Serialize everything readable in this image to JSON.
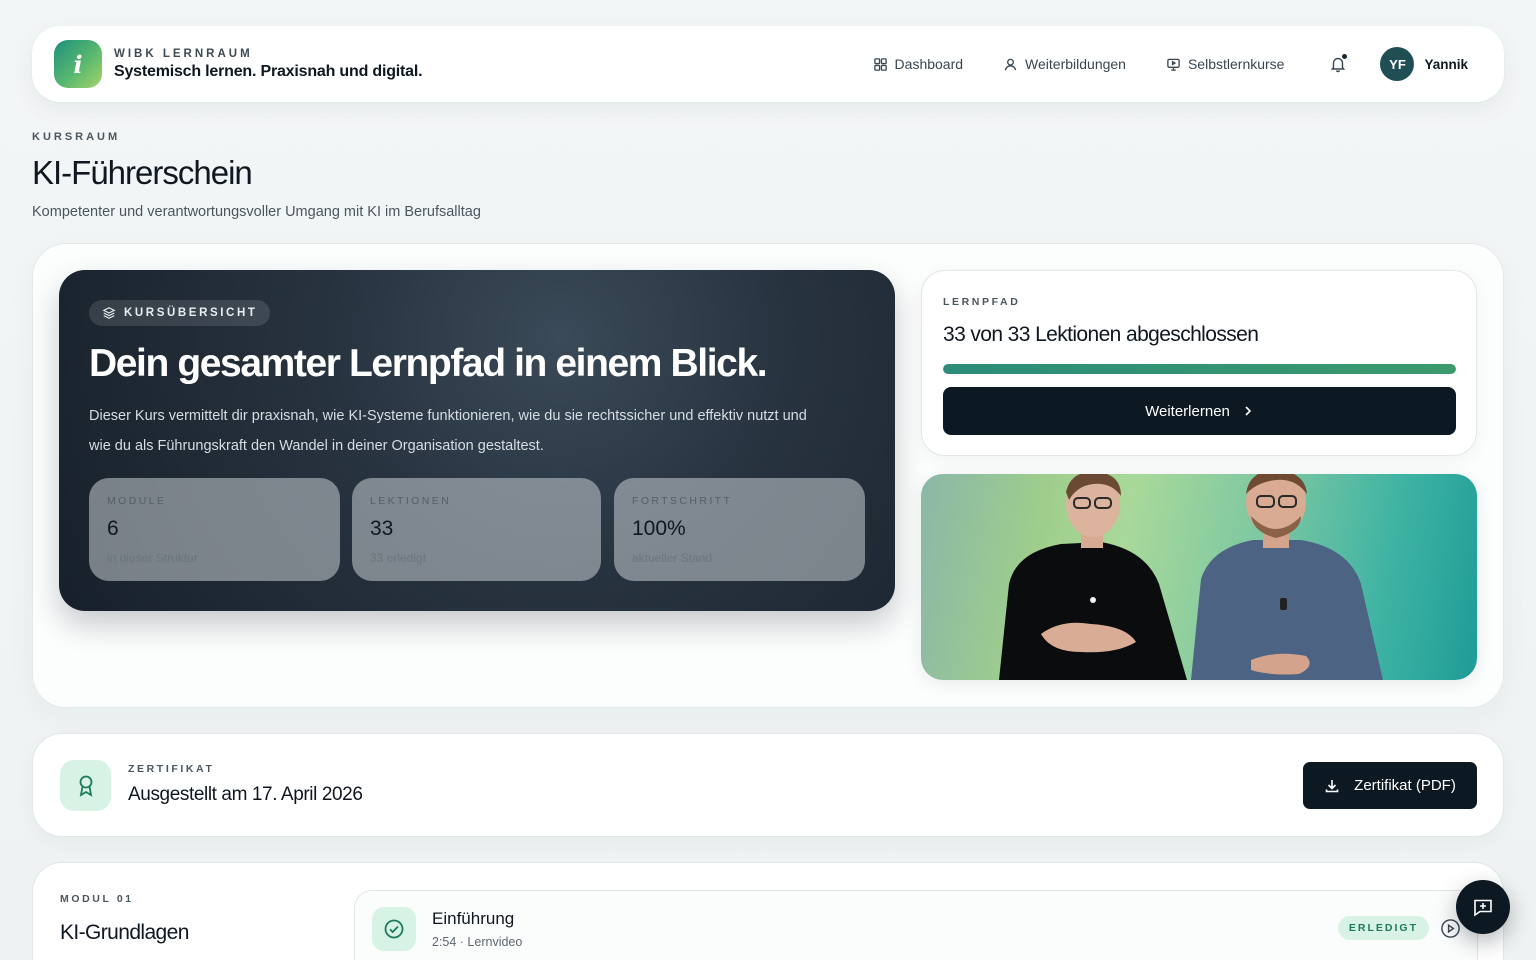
{
  "header": {
    "brand_kicker": "WIBK LERNRAUM",
    "brand_title": "Systemisch lernen. Praxisnah und digital.",
    "nav": [
      {
        "label": "Dashboard",
        "icon": "grid-icon"
      },
      {
        "label": "Weiterbildungen",
        "icon": "user-icon"
      },
      {
        "label": "Selbstlernkurse",
        "icon": "monitor-icon"
      }
    ],
    "user_initials": "YF",
    "user_name": "Yannik"
  },
  "page": {
    "kicker": "KURSRAUM",
    "title": "KI-Führerschein",
    "subtitle": "Kompetenter und verantwortungsvoller Umgang mit KI im Berufsalltag"
  },
  "hero": {
    "badge": "KURSÜBERSICHT",
    "title": "Dein gesamter Lernpfad in einem Blick.",
    "description": "Dieser Kurs vermittelt dir praxisnah, wie KI-Systeme funktionieren, wie du sie rechtssicher und effektiv nutzt und wie du als Führungskraft den Wandel in deiner Organisation gestaltest.",
    "stats": [
      {
        "label": "MODULE",
        "value": "6",
        "note": "in dieser Struktur"
      },
      {
        "label": "LEKTIONEN",
        "value": "33",
        "note": "33 erledigt"
      },
      {
        "label": "FORTSCHRITT",
        "value": "100%",
        "note": "aktueller Stand"
      }
    ]
  },
  "learning_path": {
    "kicker": "LERNPFAD",
    "title": "33 von 33 Lektionen abgeschlossen",
    "progress_percent": 100,
    "button_label": "Weiterlernen"
  },
  "certificate": {
    "kicker": "ZERTIFIKAT",
    "title": "Ausgestellt am 17. April 2026",
    "button_label": "Zertifikat (PDF)"
  },
  "module": {
    "kicker": "MODUL 01",
    "title": "KI-Grundlagen",
    "lessons": [
      {
        "title": "Einführung",
        "meta": "2:54 · Lernvideo",
        "status": "ERLEDIGT"
      }
    ]
  },
  "colors": {
    "accent": "#2d8c7a",
    "dark_button": "#0c1822",
    "success_bg": "#d6f3e6"
  }
}
